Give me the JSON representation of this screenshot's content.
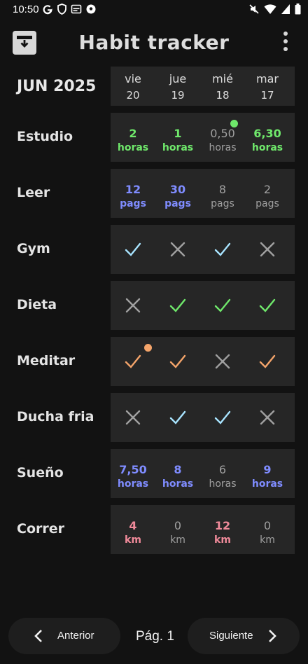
{
  "status": {
    "time": "10:50"
  },
  "app": {
    "title": "Habit tracker"
  },
  "month": "JUN 2025",
  "days": [
    {
      "weekday": "vie",
      "date": "20"
    },
    {
      "weekday": "jue",
      "date": "19"
    },
    {
      "weekday": "mié",
      "date": "18"
    },
    {
      "weekday": "mar",
      "date": "17"
    }
  ],
  "colors": {
    "green": "#6fe86b",
    "blue": "#7f8cff",
    "cyan": "#a8e4ff",
    "orange": "#f4a46a",
    "pink": "#f08a9a",
    "gray": "#a0a0a0"
  },
  "habits": [
    {
      "name": "Estudio",
      "kind": "value",
      "color": "green",
      "dot_color": "#6fe86b",
      "cells": [
        {
          "value": "2",
          "unit": "horas",
          "on": true
        },
        {
          "value": "1",
          "unit": "horas",
          "on": true
        },
        {
          "value": "0,50",
          "unit": "horas",
          "on": false,
          "dot": true
        },
        {
          "value": "6,30",
          "unit": "horas",
          "on": true
        }
      ]
    },
    {
      "name": "Leer",
      "kind": "value",
      "color": "blue",
      "cells": [
        {
          "value": "12",
          "unit": "pags",
          "on": true
        },
        {
          "value": "30",
          "unit": "pags",
          "on": true
        },
        {
          "value": "8",
          "unit": "pags",
          "on": false
        },
        {
          "value": "2",
          "unit": "pags",
          "on": false
        }
      ]
    },
    {
      "name": "Gym",
      "kind": "check",
      "color": "cyan",
      "cells": [
        {
          "done": true
        },
        {
          "done": false
        },
        {
          "done": true
        },
        {
          "done": false
        }
      ]
    },
    {
      "name": "Dieta",
      "kind": "check",
      "color": "green",
      "cells": [
        {
          "done": false
        },
        {
          "done": true
        },
        {
          "done": true
        },
        {
          "done": true
        }
      ]
    },
    {
      "name": "Meditar",
      "kind": "check",
      "color": "orange",
      "dot_color": "#f4a46a",
      "cells": [
        {
          "done": true,
          "dot": true
        },
        {
          "done": true
        },
        {
          "done": false
        },
        {
          "done": true
        }
      ]
    },
    {
      "name": "Ducha fria",
      "kind": "check",
      "color": "cyan",
      "cells": [
        {
          "done": false
        },
        {
          "done": true
        },
        {
          "done": true
        },
        {
          "done": false
        }
      ]
    },
    {
      "name": "Sueño",
      "kind": "value",
      "color": "blue",
      "cells": [
        {
          "value": "7,50",
          "unit": "horas",
          "on": true
        },
        {
          "value": "8",
          "unit": "horas",
          "on": true
        },
        {
          "value": "6",
          "unit": "horas",
          "on": false
        },
        {
          "value": "9",
          "unit": "horas",
          "on": true
        }
      ]
    },
    {
      "name": "Correr",
      "kind": "value",
      "color": "pink",
      "cells": [
        {
          "value": "4",
          "unit": "km",
          "on": true
        },
        {
          "value": "0",
          "unit": "km",
          "on": false
        },
        {
          "value": "12",
          "unit": "km",
          "on": true
        },
        {
          "value": "0",
          "unit": "km",
          "on": false
        }
      ]
    }
  ],
  "pager": {
    "prev_label": "Anterior",
    "page_label": "Pág. 1",
    "next_label": "Siguiente"
  }
}
